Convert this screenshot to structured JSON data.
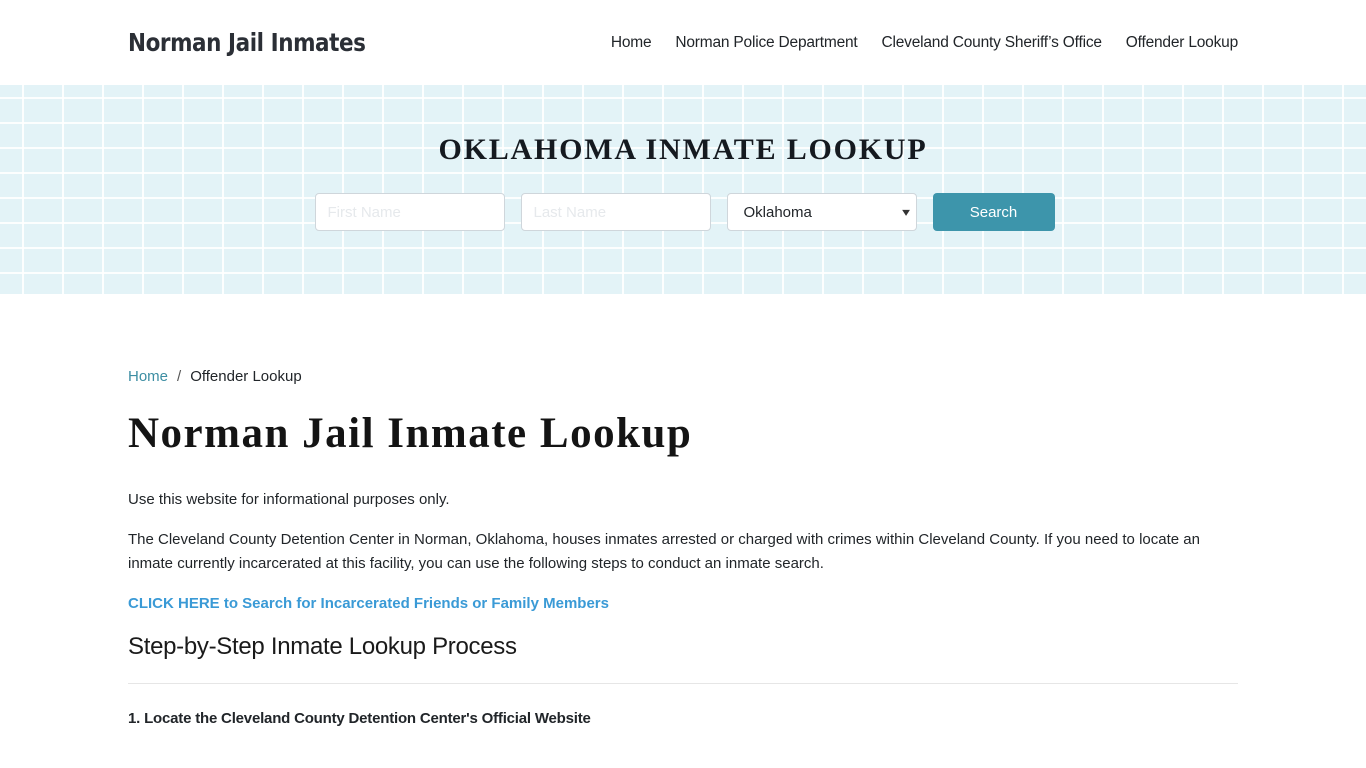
{
  "header": {
    "brand": "Norman Jail Inmates",
    "nav": [
      {
        "label": "Home"
      },
      {
        "label": "Norman Police Department"
      },
      {
        "label": "Cleveland County Sheriff’s Office"
      },
      {
        "label": "Offender Lookup"
      }
    ]
  },
  "hero": {
    "title": "OKLAHOMA INMATE LOOKUP",
    "first_name_placeholder": "First Name",
    "last_name_placeholder": "Last Name",
    "state_selected": "Oklahoma",
    "search_label": "Search",
    "chevron_icon": "▾"
  },
  "breadcrumb": {
    "home": "Home",
    "separator": "/",
    "current": "Offender Lookup"
  },
  "main": {
    "title": "Norman Jail Inmate Lookup",
    "intro": "Use this website for informational purposes only.",
    "description": "The Cleveland County Detention Center in Norman, Oklahoma, houses inmates arrested or charged with crimes within Cleveland County. If you need to locate an inmate currently incarcerated at this facility, you can use the following steps to conduct an inmate search.",
    "cta_link": "CLICK HERE to Search for Incarcerated Friends or Family Members",
    "section_title": "Step-by-Step Inmate Lookup Process",
    "step_1": "1. Locate the Cleveland County Detention Center's Official Website"
  },
  "colors": {
    "accent": "#3d95ab",
    "link": "#3a9ad6",
    "hero_bg": "#e3f3f7"
  }
}
